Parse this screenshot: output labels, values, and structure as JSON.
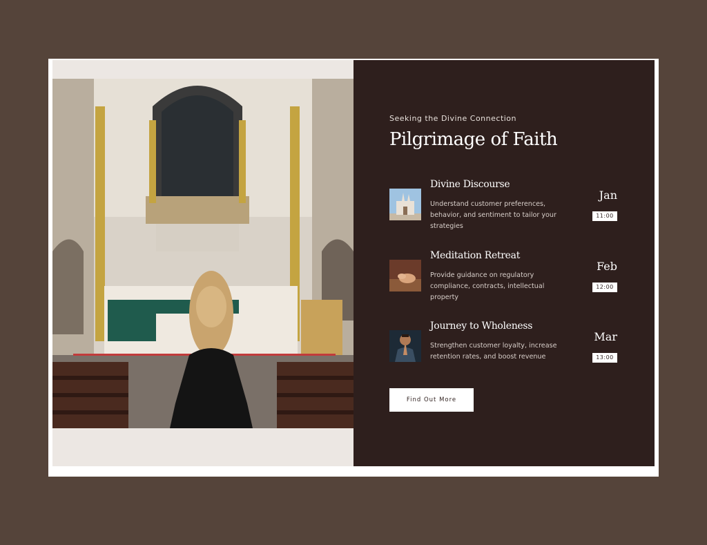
{
  "hero": {
    "eyebrow": "Seeking the Divine Connection",
    "title": "Pilgrimage of Faith",
    "image": "church-interior-woman-praying"
  },
  "events": [
    {
      "title": "Divine Discourse",
      "description": "Understand customer preferences, behavior, and sentiment to tailor your strategies",
      "month": "Jan",
      "time": "11:00",
      "thumbnail": "cathedral-exterior"
    },
    {
      "title": "Meditation Retreat",
      "description": "Provide guidance on regulatory compliance, contracts, intellectual property",
      "month": "Feb",
      "time": "12:00",
      "thumbnail": "prayer-hands-on-table"
    },
    {
      "title": "Journey to Wholeness",
      "description": "Strengthen customer loyalty, increase retention rates, and boost revenue",
      "month": "Mar",
      "time": "13:00",
      "thumbnail": "man-praying"
    }
  ],
  "cta": {
    "label": "Find Out More"
  },
  "colors": {
    "page_background": "#55443a",
    "panel_dark": "#2e1f1d",
    "panel_light": "#ece7e3",
    "frame": "#ffffff"
  }
}
